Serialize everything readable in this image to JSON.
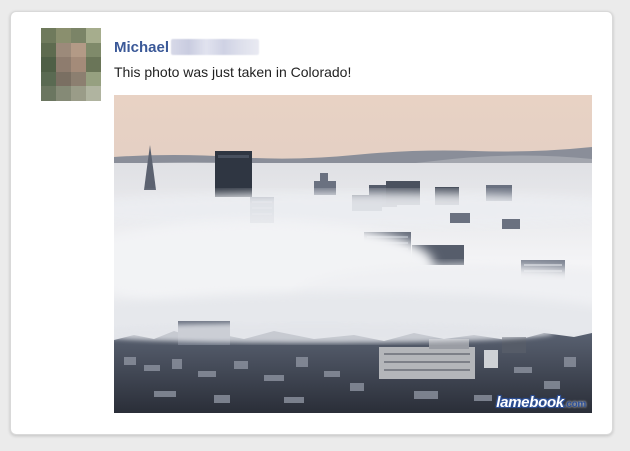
{
  "post": {
    "author_name": "Michael",
    "text": "This photo was just taken in Colorado!"
  },
  "watermark": {
    "main": "lamebook",
    "tld": ".com"
  },
  "colors": {
    "author_link": "#3b5998",
    "watermark_blue": "#2c4f96",
    "card_background": "#ffffff",
    "page_background": "#ebebeb"
  },
  "icons": {
    "avatar": "pixelated-profile-photo",
    "photo": "foggy-city-skyline-photo"
  }
}
